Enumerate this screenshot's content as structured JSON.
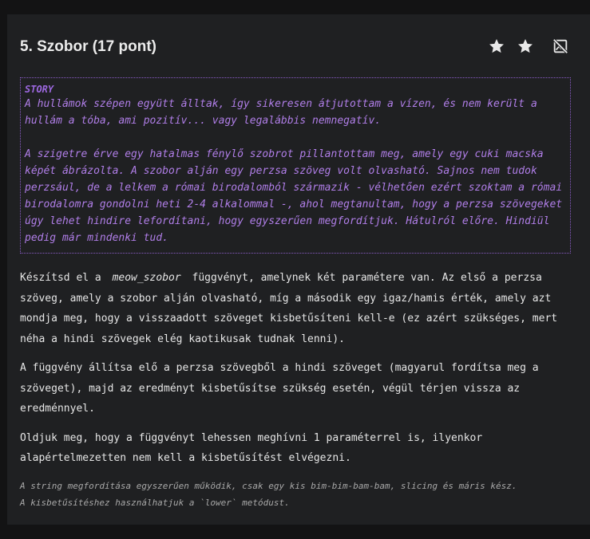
{
  "task": {
    "title": "5. Szobor (17 pont)"
  },
  "story": {
    "label": "STORY",
    "paragraph1": "A hullámok szépen együtt álltak, így sikeresen átjutottam a vízen, és nem került a hullám a tóba, ami pozitív... vagy legalábbis nemnegatív.",
    "paragraph2": "A szigetre érve egy hatalmas fénylő szobrot pillantottam meg, amely egy cuki macska képét ábrázolta. A szobor alján egy perzsa szöveg volt olvasható. Sajnos nem tudok perzsául, de a lelkem a római birodalomból származik - vélhetően ezért szoktam a római birodalomra gondolni heti 2-4 alkalommal -, ahol megtanultam, hogy a perzsa szövegeket úgy lehet hindire lefordítani, hogy egyszerűen megfordítjuk. Hátulról előre. Hindiül pedig már mindenki tud."
  },
  "body": {
    "p1_before": "Készítsd el a",
    "function_name": "meow_szobor",
    "p1_after": "függvényt, amelynek két paramétere van. Az első a perzsa szöveg, amely a szobor alján olvasható, míg a második egy igaz/hamis érték, amely azt mondja meg, hogy a visszaadott szöveget kisbetűsíteni kell-e (ez azért szükséges, mert néha a hindi szövegek elég kaotikusak tudnak lenni).",
    "p2": "A függvény állítsa elő a perzsa szövegből a hindi szöveget (magyarul fordítsa meg a szöveget), majd az eredményt kisbetűsítse szükség esetén, végül térjen vissza az eredménnyel.",
    "p3": "Oldjuk meg, hogy a függvényt lehessen meghívni 1 paraméterrel is, ilyenkor alapértelmezetten nem kell a kisbetűsítést elvégezni."
  },
  "hints": {
    "line1": "A string megfordítása egyszerűen működik, csak egy kis bim-bim-bam-bam, slicing és máris kész.",
    "line2": "A kisbetűsítéshez használhatjuk a `lower` metódust."
  },
  "icons": {
    "star1": "star-icon",
    "star2": "star-icon",
    "hide": "image-off-icon"
  },
  "colors": {
    "accent": "#b07ee8",
    "background": "#1f2022",
    "text": "#e6e6e6"
  }
}
